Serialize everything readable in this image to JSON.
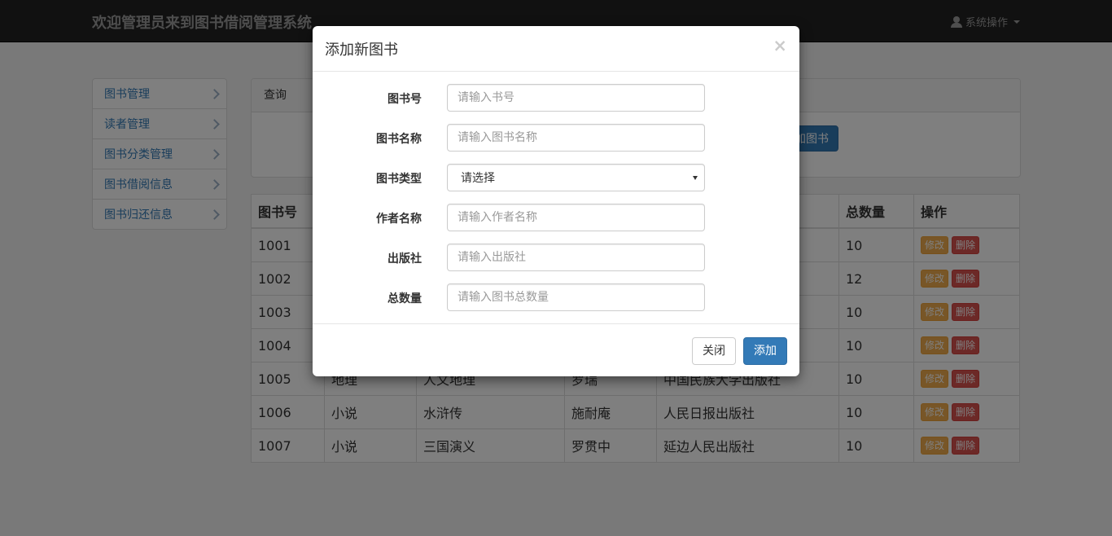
{
  "navbar": {
    "brand": "欢迎管理员来到图书借阅管理系统",
    "user_menu": "系统操作"
  },
  "sidebar": {
    "items": [
      {
        "label": "图书管理"
      },
      {
        "label": "读者管理"
      },
      {
        "label": "图书分类管理"
      },
      {
        "label": "图书借阅信息"
      },
      {
        "label": "图书归还信息"
      }
    ]
  },
  "query_panel": {
    "heading": "查询",
    "add_button": "加图书"
  },
  "table": {
    "headers": [
      "图书号",
      "",
      "",
      "",
      "",
      "总数量",
      "操作"
    ],
    "rows": [
      {
        "id": "1001",
        "type": "",
        "name": "",
        "author": "",
        "publisher": "",
        "total": "10"
      },
      {
        "id": "1002",
        "type": "",
        "name": "",
        "author": "",
        "publisher": "",
        "total": "12"
      },
      {
        "id": "1003",
        "type": "",
        "name": "",
        "author": "",
        "publisher": "",
        "total": "10"
      },
      {
        "id": "1004",
        "type": "",
        "name": "",
        "author": "",
        "publisher": "",
        "total": "10"
      },
      {
        "id": "1005",
        "type": "地理",
        "name": "人文地理",
        "author": "罗瑞",
        "publisher": "中国民族大学出版社",
        "total": "10"
      },
      {
        "id": "1006",
        "type": "小说",
        "name": "水浒传",
        "author": "施耐庵",
        "publisher": "人民日报出版社",
        "total": "10"
      },
      {
        "id": "1007",
        "type": "小说",
        "name": "三国演义",
        "author": "罗贯中",
        "publisher": "延边人民出版社",
        "total": "10"
      }
    ],
    "edit_label": "修改",
    "delete_label": "删除"
  },
  "modal": {
    "title": "添加新图书",
    "close_symbol": "×",
    "fields": [
      {
        "label": "图书号",
        "placeholder": "请输入书号",
        "value": ""
      },
      {
        "label": "图书名称",
        "placeholder": "请输入图书名称",
        "value": ""
      },
      {
        "label": "图书类型",
        "selected": "请选择"
      },
      {
        "label": "作者名称",
        "placeholder": "请输入作者名称",
        "value": ""
      },
      {
        "label": "出版社",
        "placeholder": "请输入出版社",
        "value": ""
      },
      {
        "label": "总数量",
        "placeholder": "请输入图书总数量",
        "value": ""
      }
    ],
    "close_button": "关闭",
    "submit_button": "添加"
  },
  "colors": {
    "primary": "#337ab7",
    "warning": "#f0ad4e",
    "danger": "#d9534f",
    "navbar": "#222222"
  },
  "icons": {
    "user": "user-icon",
    "caret": "caret-down-icon",
    "chevron": "chevron-right-icon",
    "close": "close-icon"
  }
}
